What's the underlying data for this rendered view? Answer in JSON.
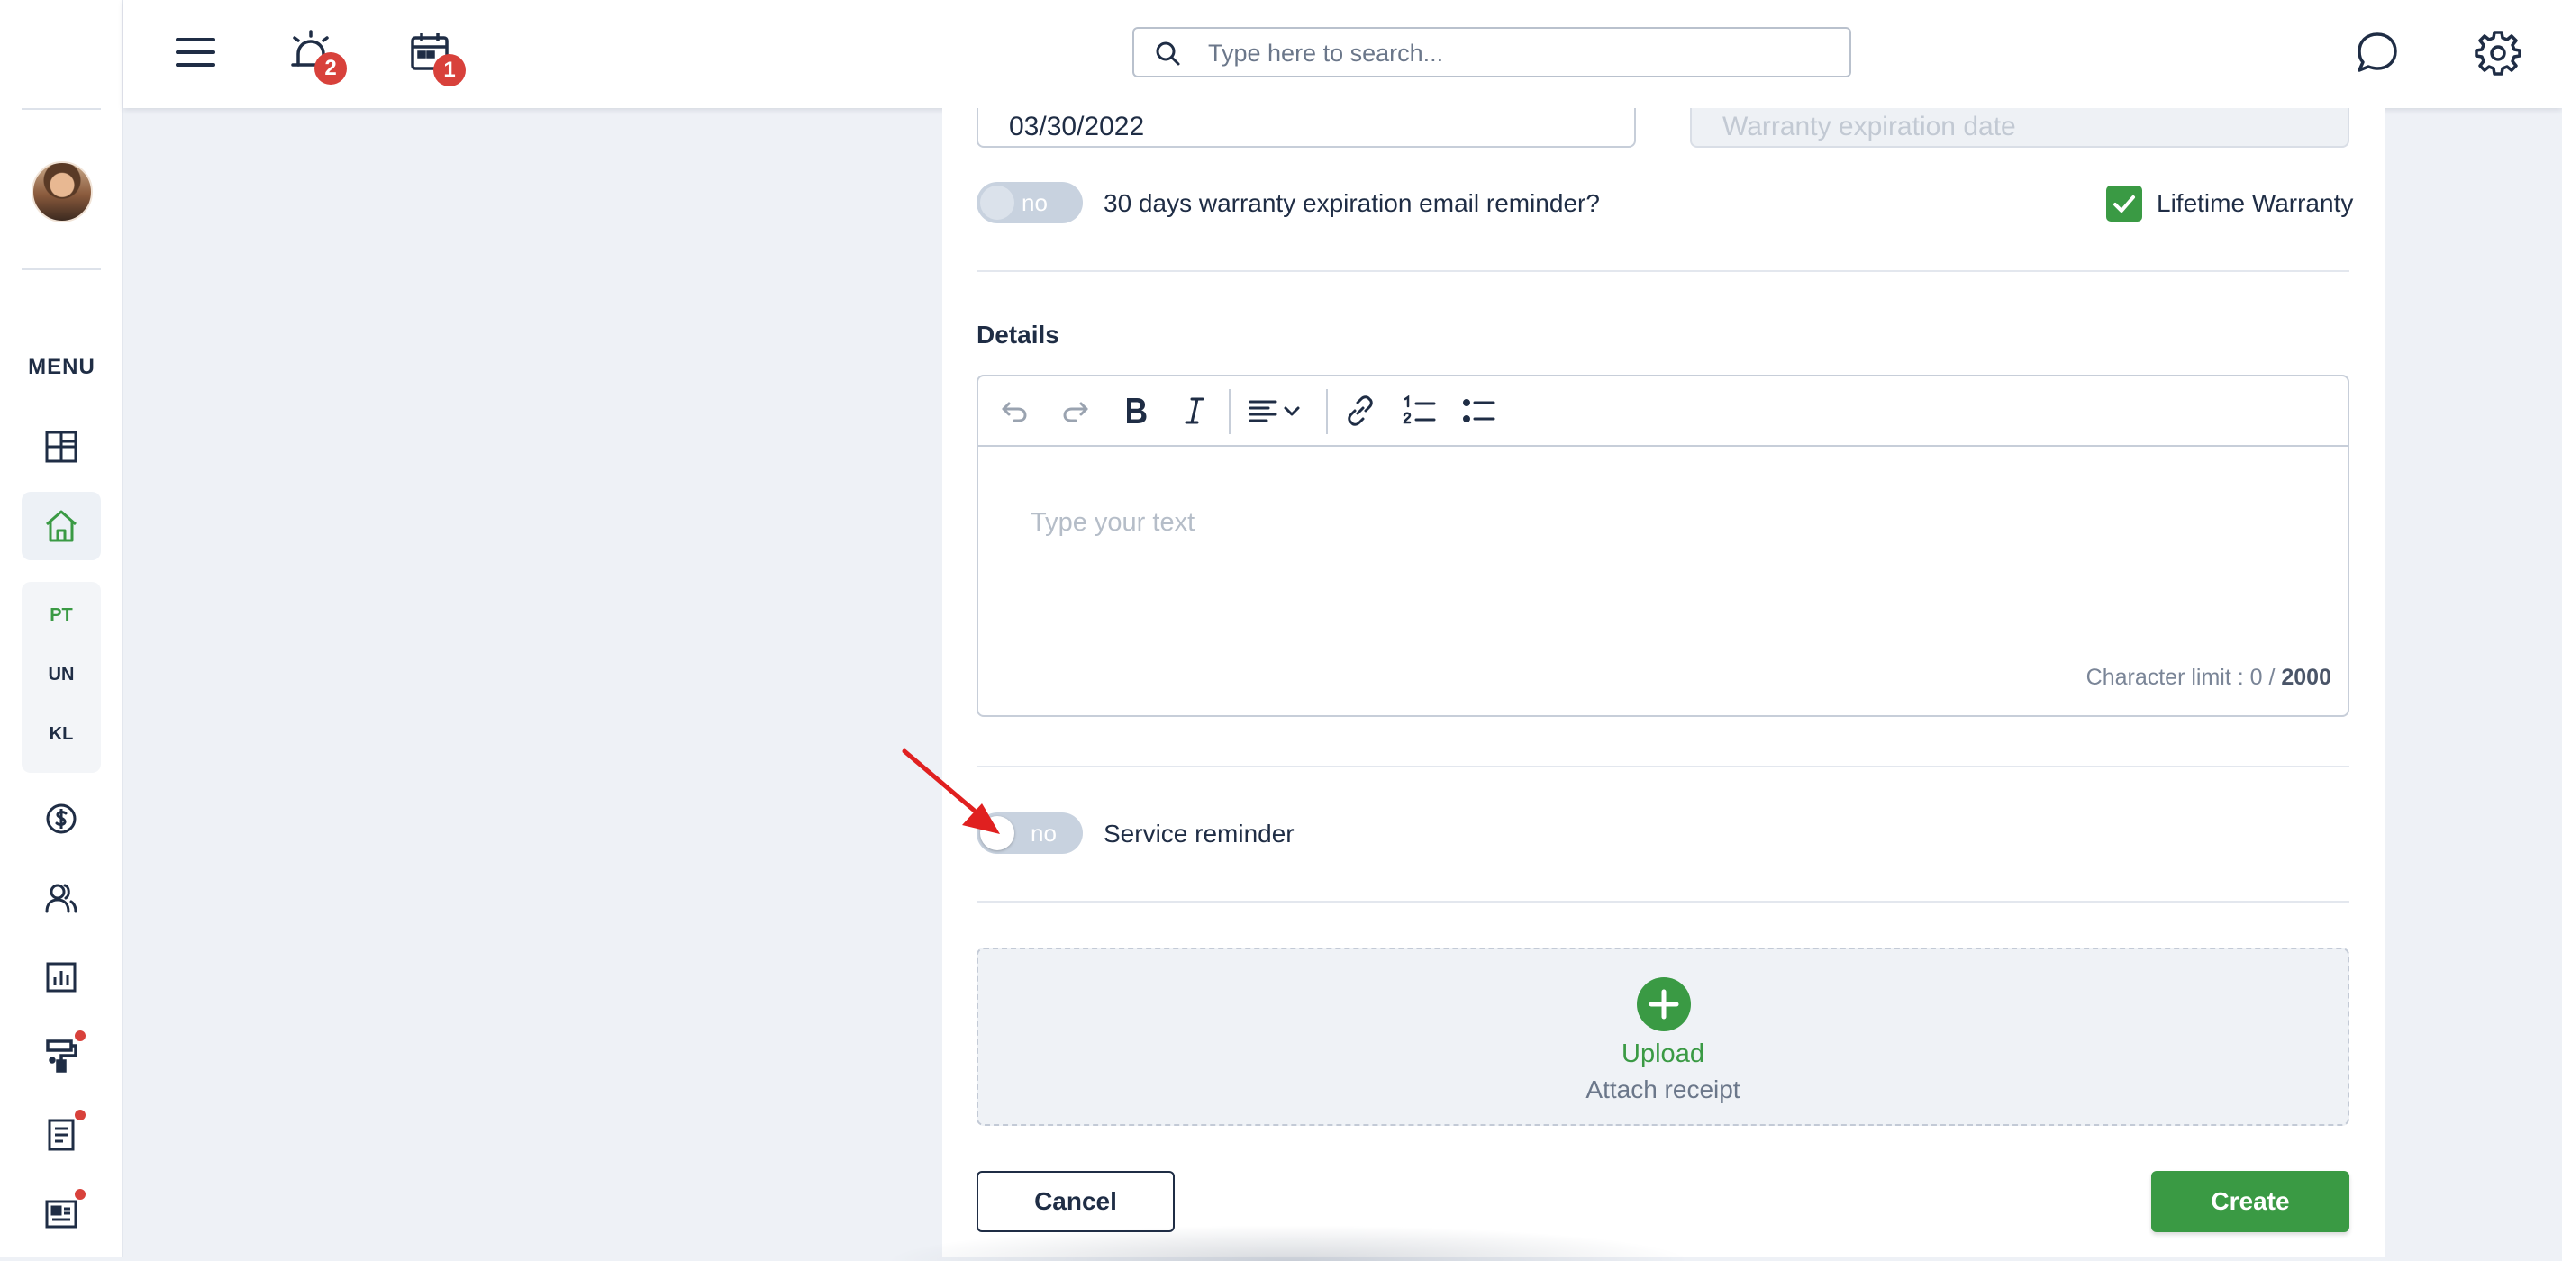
{
  "sidebar": {
    "menu_label": "MENU",
    "sub_items": [
      "PT",
      "UN",
      "KL"
    ]
  },
  "topbar": {
    "notifications_badge": "2",
    "calendar_badge": "1",
    "search_placeholder": "Type here to search..."
  },
  "form": {
    "purchase_date": "03/30/2022",
    "warranty_placeholder": "Warranty expiration date",
    "warranty_reminder": {
      "state": "no",
      "label": "30 days warranty expiration email reminder?"
    },
    "lifetime_warranty": {
      "label": "Lifetime Warranty",
      "checked": true
    },
    "details": {
      "title": "Details",
      "placeholder": "Type your text",
      "char_limit_prefix": "Character limit : 0 /",
      "char_limit_max": "2000"
    },
    "service_reminder": {
      "state": "no",
      "label": "Service reminder"
    },
    "upload": {
      "title": "Upload",
      "subtitle": "Attach receipt"
    },
    "cancel_label": "Cancel",
    "create_label": "Create"
  },
  "colors": {
    "accent_green": "#3a9a44",
    "badge_red": "#d8413b",
    "navy": "#1f2d45"
  }
}
